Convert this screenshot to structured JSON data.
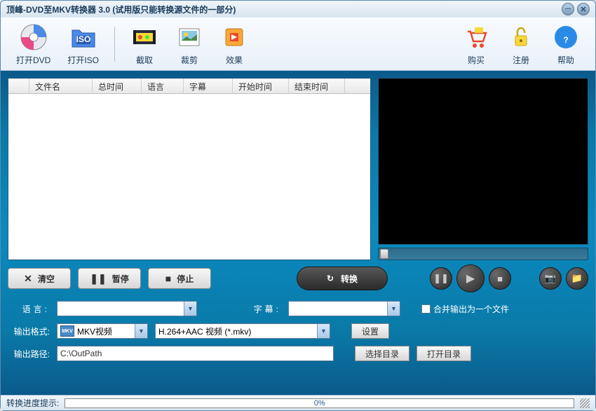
{
  "title": "顶峰-DVD至MKV转换器 3.0 (试用版只能转换源文件的一部分)",
  "toolbar": {
    "open_dvd": "打开DVD",
    "open_iso": "打开ISO",
    "capture": "截取",
    "trim": "裁剪",
    "effect": "效果",
    "buy": "购买",
    "register": "注册",
    "help": "帮助"
  },
  "table": {
    "filename": "文件名",
    "duration": "总时间",
    "language": "语言",
    "subtitle": "字幕",
    "start": "开始时间",
    "end": "结束时间"
  },
  "controls": {
    "clear": "清空",
    "pause": "暂停",
    "stop": "停止",
    "convert": "转换"
  },
  "settings": {
    "lang_label": "语言:",
    "lang_value": "",
    "sub_label": "字幕:",
    "sub_value": "",
    "merge_label": "合并输出为一个文件",
    "format_label": "输出格式:",
    "format_value": "MKV视频",
    "codec_value": "H.264+AAC 视频 (*.mkv)",
    "settings_btn": "设置",
    "path_label": "输出路径:",
    "path_value": "C:\\OutPath",
    "select_dir": "选择目录",
    "open_dir": "打开目录"
  },
  "status": {
    "label": "转换进度提示:",
    "percent": "0%"
  }
}
